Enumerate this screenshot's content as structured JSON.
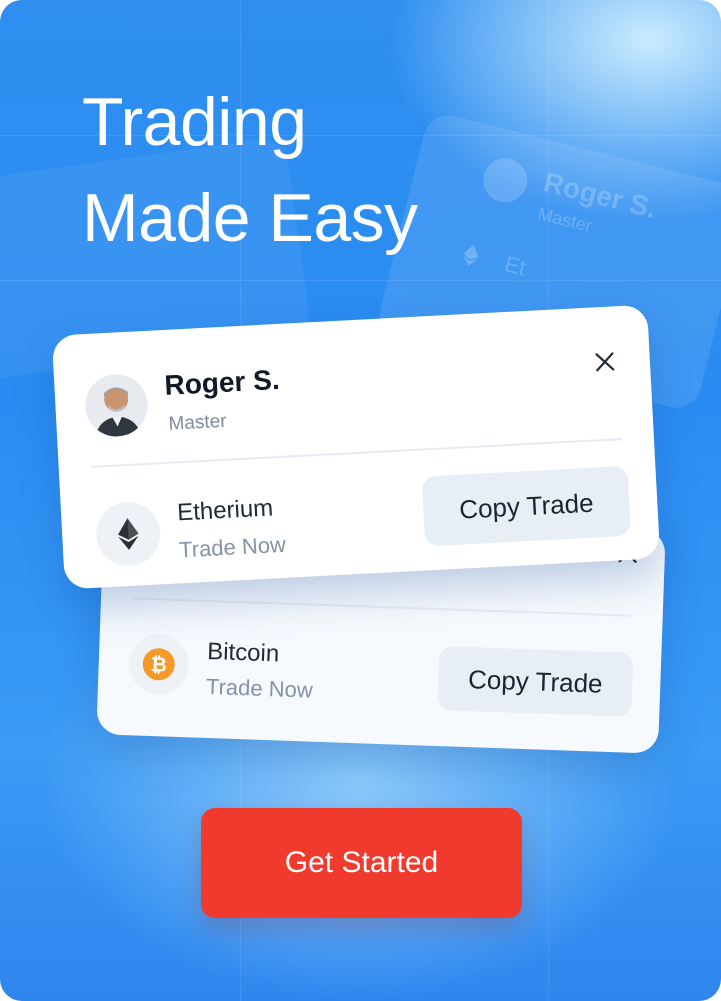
{
  "hero": {
    "title_line1": "Trading",
    "title_line2": "Made Easy"
  },
  "background_card": {
    "name": "Roger S.",
    "role": "Master",
    "coin_fragment": "Et"
  },
  "profile_card": {
    "name": "Roger S.",
    "role": "Master",
    "close_icon": "close-icon",
    "asset": {
      "name": "Etherium",
      "subtitle": "Trade Now",
      "icon": "ethereum-icon",
      "action_label": "Copy Trade"
    }
  },
  "second_card": {
    "close_icon": "close-icon",
    "asset": {
      "name": "Bitcoin",
      "subtitle": "Trade Now",
      "icon": "bitcoin-icon",
      "action_label": "Copy Trade"
    }
  },
  "cta": {
    "label": "Get Started"
  },
  "colors": {
    "background": "#2f8ef0",
    "cta": "#f03a2e",
    "bitcoin": "#f39a2b",
    "card": "#ffffff"
  }
}
